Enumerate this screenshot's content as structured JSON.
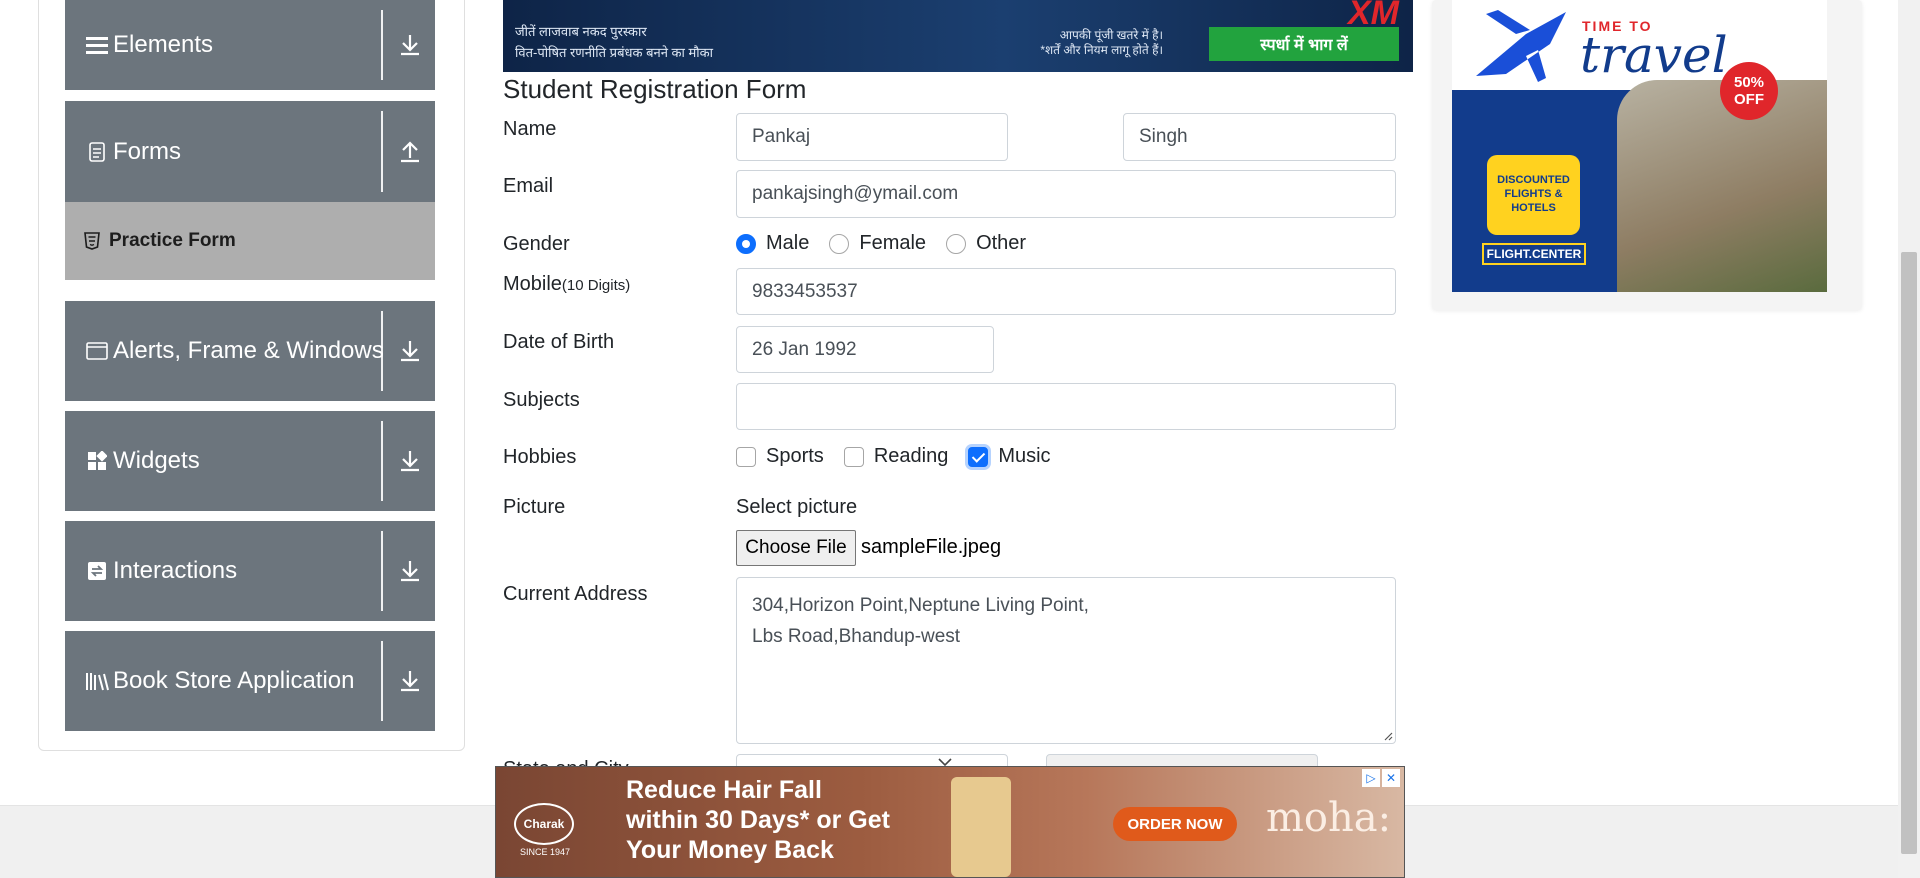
{
  "sidebar": {
    "groups": [
      {
        "label": "Elements",
        "icon": "list-icon",
        "arrow": "download-arrow-icon"
      },
      {
        "label": "Forms",
        "icon": "document-icon",
        "arrow": "upload-arrow-icon"
      },
      {
        "label": "Alerts, Frame & Windows",
        "icon": "window-icon",
        "arrow": "download-arrow-icon"
      },
      {
        "label": "Widgets",
        "icon": "widgets-icon",
        "arrow": "download-arrow-icon"
      },
      {
        "label": "Interactions",
        "icon": "interactions-icon",
        "arrow": "download-arrow-icon"
      },
      {
        "label": "Book Store Application",
        "icon": "books-icon",
        "arrow": "download-arrow-icon"
      }
    ],
    "active_item": "Practice Form"
  },
  "banner_top": {
    "line1": "जीतें लाजवाब नकद पुरस्कार",
    "line2": "वित-पोषित रणनीति प्रबंधक बनने का मौका",
    "disclaimer1": "आपकी पूंजी खतरे में है।",
    "disclaimer2": "*शर्तें और नियम लागू होते हैं।",
    "cta": "स्पर्धा में भाग लें",
    "brand": "XM"
  },
  "form": {
    "title": "Student Registration Form",
    "name_label": "Name",
    "first_name": "Pankaj",
    "last_name": "Singh",
    "email_label": "Email",
    "email": "pankajsingh@ymail.com",
    "gender_label": "Gender",
    "gender_options": [
      "Male",
      "Female",
      "Other"
    ],
    "gender_selected": "Male",
    "mobile_label": "Mobile",
    "mobile_hint": "(10 Digits)",
    "mobile": "9833453537",
    "dob_label": "Date of Birth",
    "dob": "26 Jan 1992",
    "subjects_label": "Subjects",
    "subjects": "",
    "hobbies_label": "Hobbies",
    "hobbies": [
      "Sports",
      "Reading",
      "Music"
    ],
    "hobbies_checked": [
      "Music"
    ],
    "picture_label": "Picture",
    "select_picture": "Select picture",
    "choose_file": "Choose File",
    "file_name": "sampleFile.jpeg",
    "address_label": "Current Address",
    "address_line1": "304,Horizon Point,Neptune Living Point,",
    "address_line2": "Lbs Road,Bhandup-west",
    "state_label": "State and City"
  },
  "ad_right": {
    "time_to": "TIME TO",
    "travel": "travel",
    "off1": "50%",
    "off2": "OFF",
    "disc1": "DISCOUNTED",
    "disc2": "FLIGHTS & HOTELS",
    "brand": "FLIGHT.CENTER"
  },
  "ad_bottom": {
    "logo": "Charak",
    "logo_sub": "SINCE 1947",
    "line1": "Reduce Hair Fall",
    "line2": "within 30 Days* or Get",
    "line3": "Your Money Back",
    "cta": "ORDER NOW",
    "brand": "moha:"
  },
  "colors": {
    "sidebar_bg": "#6c757d",
    "active_item_bg": "#aeaeae",
    "primary": "#0d6efd",
    "banner_cta": "#22a33e"
  }
}
